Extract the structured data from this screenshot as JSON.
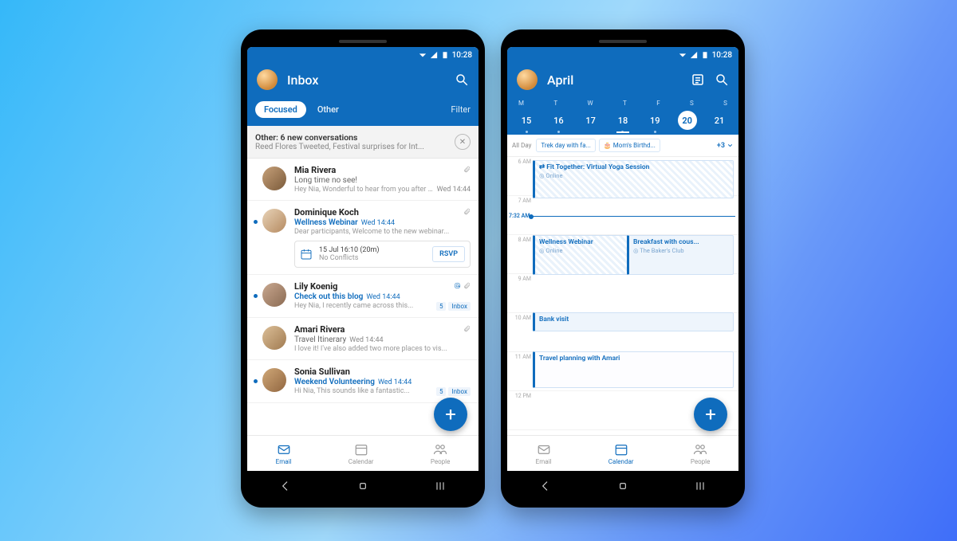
{
  "status": {
    "time": "10:28"
  },
  "inbox": {
    "title": "Inbox",
    "tabs": {
      "focused": "Focused",
      "other": "Other",
      "filter": "Filter"
    },
    "banner": {
      "title": "Other: 6 new conversations",
      "preview": "Reed Flores Tweeted, Festival surprises for Int..."
    },
    "rsvp": {
      "line1": "15 Jul 16:10 (20m)",
      "line2": "No Conflicts",
      "button": "RSVP"
    },
    "emails": [
      {
        "sender": "Mia Rivera",
        "subject": "Long time no see!",
        "preview": "Hey Nia, Wonderful to hear from you after such...",
        "time": "Wed 14:44",
        "unread": false,
        "attach": true,
        "avatar": "linear-gradient(135deg,#c7a17a,#7a5a3a)"
      },
      {
        "sender": "Dominique Koch",
        "subject": "Wellness Webinar",
        "preview": "Dear participants, Welcome to the new webinar...",
        "time": "Wed 14:44",
        "unread": true,
        "attach": true,
        "link": true,
        "avatar": "linear-gradient(135deg,#e8d3b8,#b58a60)"
      },
      {
        "sender": "Lily Koenig",
        "subject": "Check out this blog",
        "preview": "Hey Nia, I recently came across this...",
        "time": "Wed 14:44",
        "unread": true,
        "attach": true,
        "link": true,
        "mention": true,
        "tags": [
          "5",
          "Inbox"
        ],
        "avatar": "linear-gradient(135deg,#c9a890,#8a6a52)"
      },
      {
        "sender": "Amari Rivera",
        "subject": "Travel Itinerary",
        "preview": "I love it! I've also added two more places to vis...",
        "time": "Wed 14:44",
        "unread": false,
        "attach": true,
        "avatar": "linear-gradient(135deg,#dcbf98,#a07a50)"
      },
      {
        "sender": "Sonia Sullivan",
        "subject": "Weekend Volunteering",
        "preview": "Hi Nia, This sounds like a fantastic...",
        "time": "Wed 14:44",
        "unread": true,
        "link": true,
        "tags": [
          "5",
          "Inbox"
        ],
        "avatar": "linear-gradient(135deg,#d0a878,#916640)"
      }
    ]
  },
  "nav": {
    "email": "Email",
    "calendar": "Calendar",
    "people": "People"
  },
  "calendar": {
    "title": "April",
    "dayLetters": [
      "M",
      "T",
      "W",
      "T",
      "F",
      "S",
      "S"
    ],
    "dayNums": [
      "15",
      "16",
      "17",
      "18",
      "19",
      "20",
      "21"
    ],
    "selectedIndex": 5,
    "underlineIndex": 3,
    "allDay": {
      "label": "All Day",
      "chip1": "Trek day with fa...",
      "chip2": "Mom's Birthd...",
      "more": "+3"
    },
    "hours": [
      "6 AM",
      "7 AM",
      "",
      "8 AM",
      "9 AM",
      "10 AM",
      "11 AM",
      "12 PM"
    ],
    "nowLabel": "7:32 AM",
    "events": {
      "e1": {
        "title": "Fit Together: Virtual Yoga Session",
        "loc": "Online"
      },
      "e2": {
        "title": "Wellness Webinar",
        "loc": "Online"
      },
      "e3": {
        "title": "Breakfast with cous...",
        "loc": "The Baker's Club"
      },
      "e4": {
        "title": "Bank visit"
      },
      "e5": {
        "title": "Travel planning with Amari"
      }
    }
  }
}
